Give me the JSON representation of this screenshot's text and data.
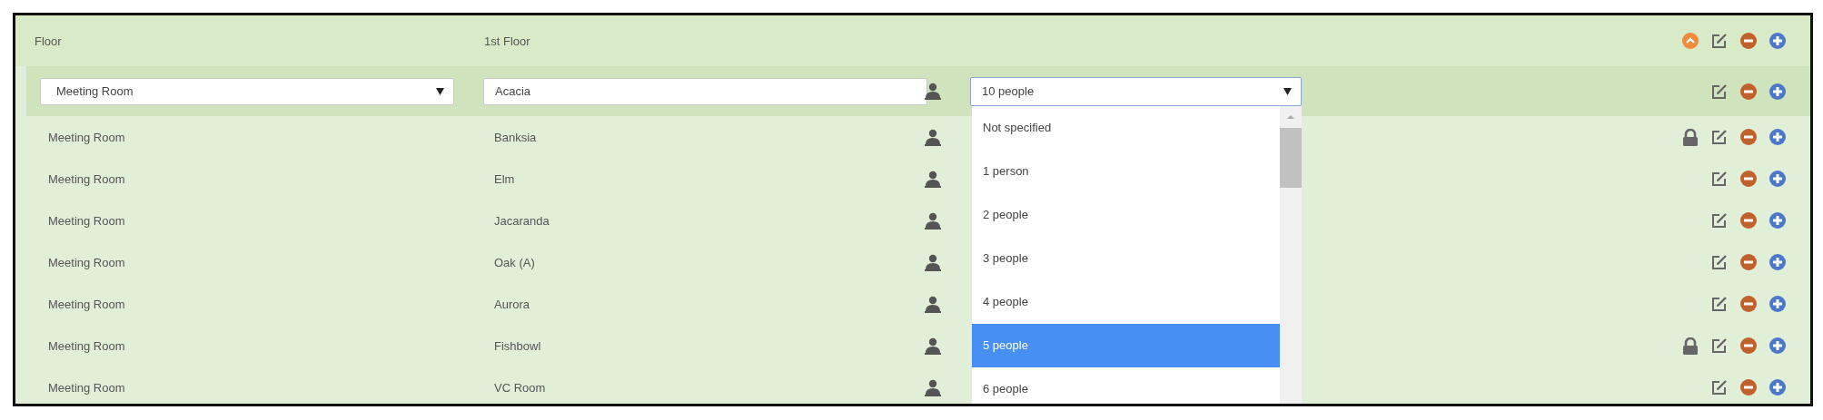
{
  "floor_row": {
    "label": "Floor",
    "value": "1st Floor"
  },
  "edit_row": {
    "type_select": "Meeting Room",
    "name_field": "Acacia",
    "capacity_select": "10 people",
    "capacity_options": [
      {
        "label": "Not specified",
        "selected": false
      },
      {
        "label": "1 person",
        "selected": false
      },
      {
        "label": "2 people",
        "selected": false
      },
      {
        "label": "3 people",
        "selected": false
      },
      {
        "label": "4 people",
        "selected": false
      },
      {
        "label": "5 people",
        "selected": true
      },
      {
        "label": "6 people",
        "selected": false
      }
    ]
  },
  "rooms": [
    {
      "type": "Meeting Room",
      "name": "Banksia",
      "locked": true
    },
    {
      "type": "Meeting Room",
      "name": "Elm",
      "locked": false
    },
    {
      "type": "Meeting Room",
      "name": "Jacaranda",
      "locked": false
    },
    {
      "type": "Meeting Room",
      "name": "Oak (A)",
      "locked": false
    },
    {
      "type": "Meeting Room",
      "name": "Aurora",
      "locked": false
    },
    {
      "type": "Meeting Room",
      "name": "Fishbowl",
      "locked": true
    },
    {
      "type": "Meeting Room",
      "name": "VC Room",
      "locked": false
    }
  ]
}
